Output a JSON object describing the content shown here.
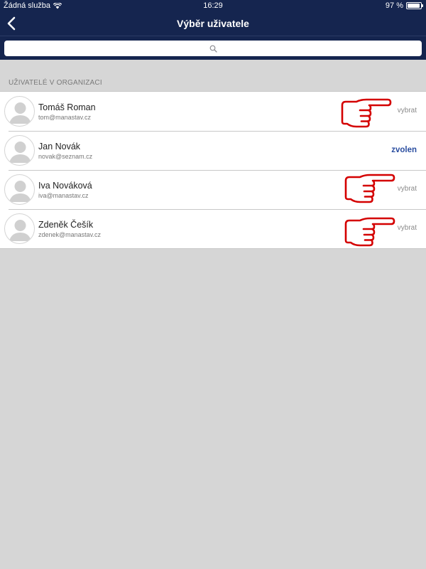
{
  "status_bar": {
    "carrier": "Žádná služba",
    "time": "16:29",
    "battery": "97 %",
    "battery_level": 0.97
  },
  "nav": {
    "title": "Výběr uživatele",
    "back_icon": "chevron-left-icon"
  },
  "search": {
    "icon": "search-icon"
  },
  "section": {
    "header": "UŽIVATELÉ V ORGANIZACI"
  },
  "users": [
    {
      "name": "Tomáš Roman",
      "email": "tom@manastav.cz",
      "action": "vybrat",
      "selected": false
    },
    {
      "name": "Jan Novák",
      "email": "novak@seznam.cz",
      "action": "zvolen",
      "selected": true
    },
    {
      "name": "Iva Nováková",
      "email": "iva@manastav.cz",
      "action": "vybrat",
      "selected": false
    },
    {
      "name": "Zdeněk Češík",
      "email": "zdenek@manastav.cz",
      "action": "vybrat",
      "selected": false
    }
  ],
  "colors": {
    "header_bg": "#15254f",
    "selected_accent": "#2b4ea0",
    "annotation_red": "#d40000"
  }
}
